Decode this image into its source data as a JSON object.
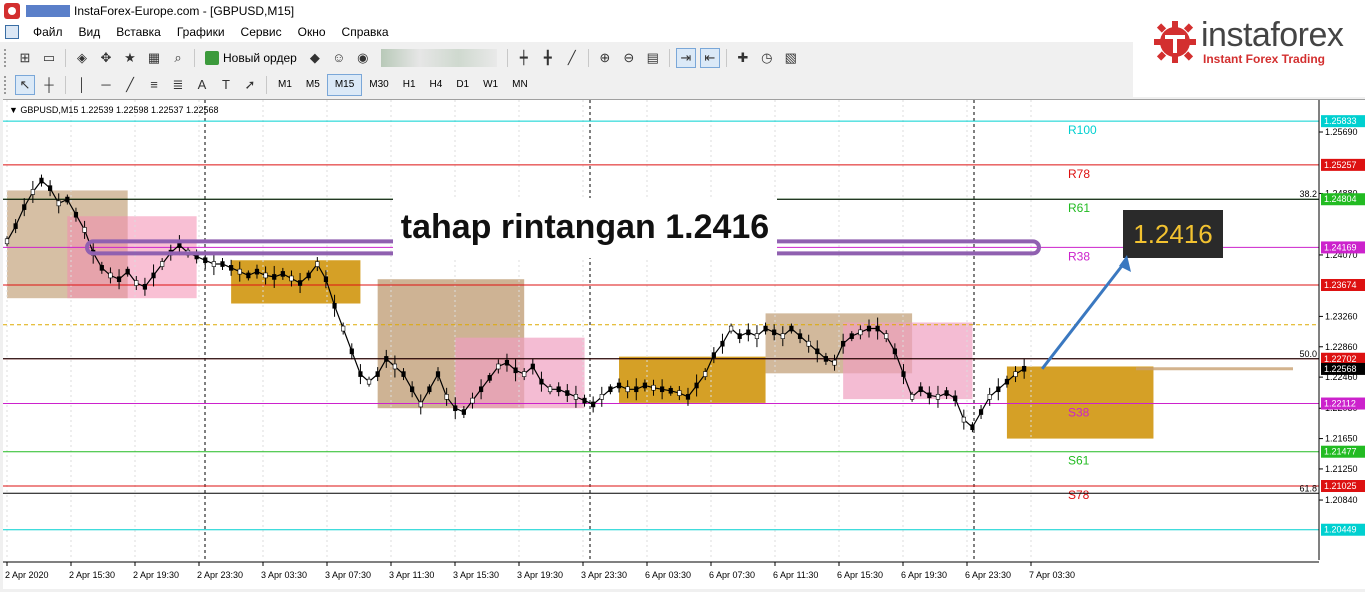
{
  "window": {
    "title": "InstaForex-Europe.com - [GBPUSD,M15]"
  },
  "menu": {
    "items": [
      "Файл",
      "Вид",
      "Вставка",
      "Графики",
      "Сервис",
      "Окно",
      "Справка"
    ]
  },
  "toolbar": {
    "new_order_label": "Новый ордер",
    "timeframes": [
      "M1",
      "M5",
      "M15",
      "M30",
      "H1",
      "H4",
      "D1",
      "W1",
      "MN"
    ],
    "active_timeframe": "M15"
  },
  "brand": {
    "name": "instaforex",
    "tagline": "Instant Forex Trading",
    "color": "#d32f2f"
  },
  "chart": {
    "symbol_info": "GBPUSD,M15  1.22539 1.22598 1.22537 1.22568",
    "headline": "tahap rintangan  1.2416",
    "callout": "1.2416",
    "current_price": "1.22568",
    "fib_labels": [
      "38.2",
      "50.0",
      "61.8"
    ]
  },
  "chart_data": {
    "type": "line",
    "symbol": "GBPUSD",
    "timeframe": "M15",
    "ylim": [
      1.2005,
      1.2598
    ],
    "y_ticks": [
      "1.25690",
      "1.24880",
      "1.24070",
      "1.23260",
      "1.22860",
      "1.22460",
      "1.22050",
      "1.21650",
      "1.21250",
      "1.20840"
    ],
    "x_ticks": [
      "2 Apr 2020",
      "2 Apr 15:30",
      "2 Apr 19:30",
      "2 Apr 23:30",
      "3 Apr 03:30",
      "3 Apr 07:30",
      "3 Apr 11:30",
      "3 Apr 15:30",
      "3 Apr 19:30",
      "3 Apr 23:30",
      "6 Apr 03:30",
      "6 Apr 07:30",
      "6 Apr 11:30",
      "6 Apr 15:30",
      "6 Apr 19:30",
      "6 Apr 23:30",
      "7 Apr 03:30"
    ],
    "levels": [
      {
        "name": "R100",
        "price": 1.25833,
        "tag": "1.25833",
        "color": "#00d0d0"
      },
      {
        "name": "R78",
        "price": 1.25257,
        "tag": "1.25257",
        "color": "#dd1111"
      },
      {
        "name": "R61",
        "price": 1.24804,
        "tag": "1.24804",
        "color": "#22bb22"
      },
      {
        "name": "R38",
        "price": 1.24169,
        "tag": "1.24169",
        "color": "#cc22cc"
      },
      {
        "name": "",
        "price": 1.23674,
        "tag": "1.23674",
        "color": "#dd1111"
      },
      {
        "name": "",
        "price": 1.2315,
        "tag": "",
        "color": "#ddaa00"
      },
      {
        "name": "",
        "price": 1.22702,
        "tag": "1.22702",
        "color": "#dd1111"
      },
      {
        "name": "S38",
        "price": 1.22112,
        "tag": "1.22112",
        "color": "#cc22cc"
      },
      {
        "name": "S61",
        "price": 1.21477,
        "tag": "1.21477",
        "color": "#22bb22"
      },
      {
        "name": "S78",
        "price": 1.21025,
        "tag": "1.21025",
        "color": "#dd1111"
      },
      {
        "name": "",
        "price": 1.20449,
        "tag": "1.20449",
        "color": "#00d0d0"
      }
    ],
    "series": [
      {
        "values": [
          1.2425,
          1.2445,
          1.247,
          1.249,
          1.2505,
          1.2495,
          1.2475,
          1.248,
          1.246,
          1.244,
          1.241,
          1.239,
          1.238,
          1.2375,
          1.2385,
          1.237,
          1.2365,
          1.238,
          1.2395,
          1.241,
          1.242,
          1.241,
          1.2405,
          1.24,
          1.2395,
          1.2395,
          1.239,
          1.2385,
          1.238,
          1.2385,
          1.238,
          1.2378,
          1.2382,
          1.2376,
          1.237,
          1.238,
          1.2395,
          1.2375,
          1.234,
          1.231,
          1.228,
          1.225,
          1.224,
          1.225,
          1.227,
          1.226,
          1.225,
          1.223,
          1.221,
          1.223,
          1.225,
          1.222,
          1.2205,
          1.22,
          1.2215,
          1.223,
          1.2245,
          1.226,
          1.2265,
          1.2255,
          1.225,
          1.226,
          1.224,
          1.223,
          1.223,
          1.2225,
          1.222,
          1.2215,
          1.221,
          1.222,
          1.223,
          1.2235,
          1.223,
          1.223,
          1.2235,
          1.2232,
          1.223,
          1.2228,
          1.2225,
          1.222,
          1.2235,
          1.225,
          1.2275,
          1.229,
          1.231,
          1.23,
          1.2305,
          1.23,
          1.231,
          1.2305,
          1.23,
          1.231,
          1.23,
          1.229,
          1.228,
          1.227,
          1.2265,
          1.229,
          1.23,
          1.2305,
          1.231,
          1.231,
          1.23,
          1.228,
          1.225,
          1.222,
          1.223,
          1.2222,
          1.222,
          1.2225,
          1.2218,
          1.219,
          1.218,
          1.22,
          1.222,
          1.223,
          1.224,
          1.225,
          1.2257
        ],
        "color": "#000000"
      }
    ],
    "zones": [
      {
        "from": 0,
        "to": 14,
        "high": 1.2492,
        "low": 1.235,
        "color": "#b48a5a",
        "opacity": 0.55
      },
      {
        "from": 7,
        "to": 22,
        "high": 1.2458,
        "low": 1.235,
        "color": "#f48cb0",
        "opacity": 0.55
      },
      {
        "from": 26,
        "to": 41,
        "high": 1.24,
        "low": 1.2343,
        "color": "#d39b1a",
        "opacity": 0.95
      },
      {
        "from": 43,
        "to": 60,
        "high": 1.2375,
        "low": 1.2205,
        "color": "#b48a5a",
        "opacity": 0.65
      },
      {
        "from": 52,
        "to": 67,
        "high": 1.2298,
        "low": 1.2205,
        "color": "#f0a0c0",
        "opacity": 0.7
      },
      {
        "from": 71,
        "to": 88,
        "high": 1.2273,
        "low": 1.2212,
        "color": "#d39b1a",
        "opacity": 0.95
      },
      {
        "from": 88,
        "to": 105,
        "high": 1.233,
        "low": 1.2251,
        "color": "#b48a5a",
        "opacity": 0.6
      },
      {
        "from": 97,
        "to": 112,
        "high": 1.2318,
        "low": 1.2217,
        "color": "#f0a0c0",
        "opacity": 0.7
      },
      {
        "from": 116,
        "to": 133,
        "high": 1.226,
        "low": 1.2165,
        "color": "#d39b1a",
        "opacity": 0.95
      }
    ]
  }
}
